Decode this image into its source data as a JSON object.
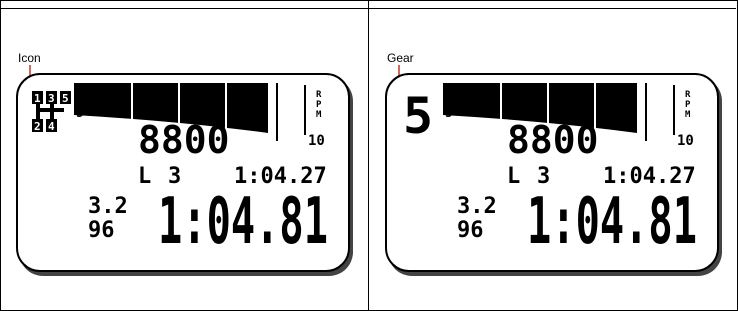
{
  "panels": [
    {
      "callout": "Icon",
      "display": {
        "gear_icons": [
          "1",
          "3",
          "5",
          "2",
          "4"
        ],
        "gear_small": "5",
        "rpm": "8800",
        "rpm_label": [
          "R",
          "P",
          "M"
        ],
        "scale_value": "10",
        "lap_label": "L",
        "lap_number": "3",
        "lap_time": "1:04.27",
        "split_top": "3.2",
        "split_bottom": "96",
        "main_time": "1:04.81"
      }
    },
    {
      "callout": "Gear",
      "display": {
        "gear_big": "5",
        "gear_small": "5",
        "rpm": "8800",
        "rpm_label": [
          "R",
          "P",
          "M"
        ],
        "scale_value": "10",
        "lap_label": "L",
        "lap_number": "3",
        "lap_time": "1:04.27",
        "split_top": "3.2",
        "split_bottom": "96",
        "main_time": "1:04.81"
      }
    }
  ],
  "colors": {
    "callout_line": "#c0392b",
    "lcd_ink": "#000000"
  }
}
